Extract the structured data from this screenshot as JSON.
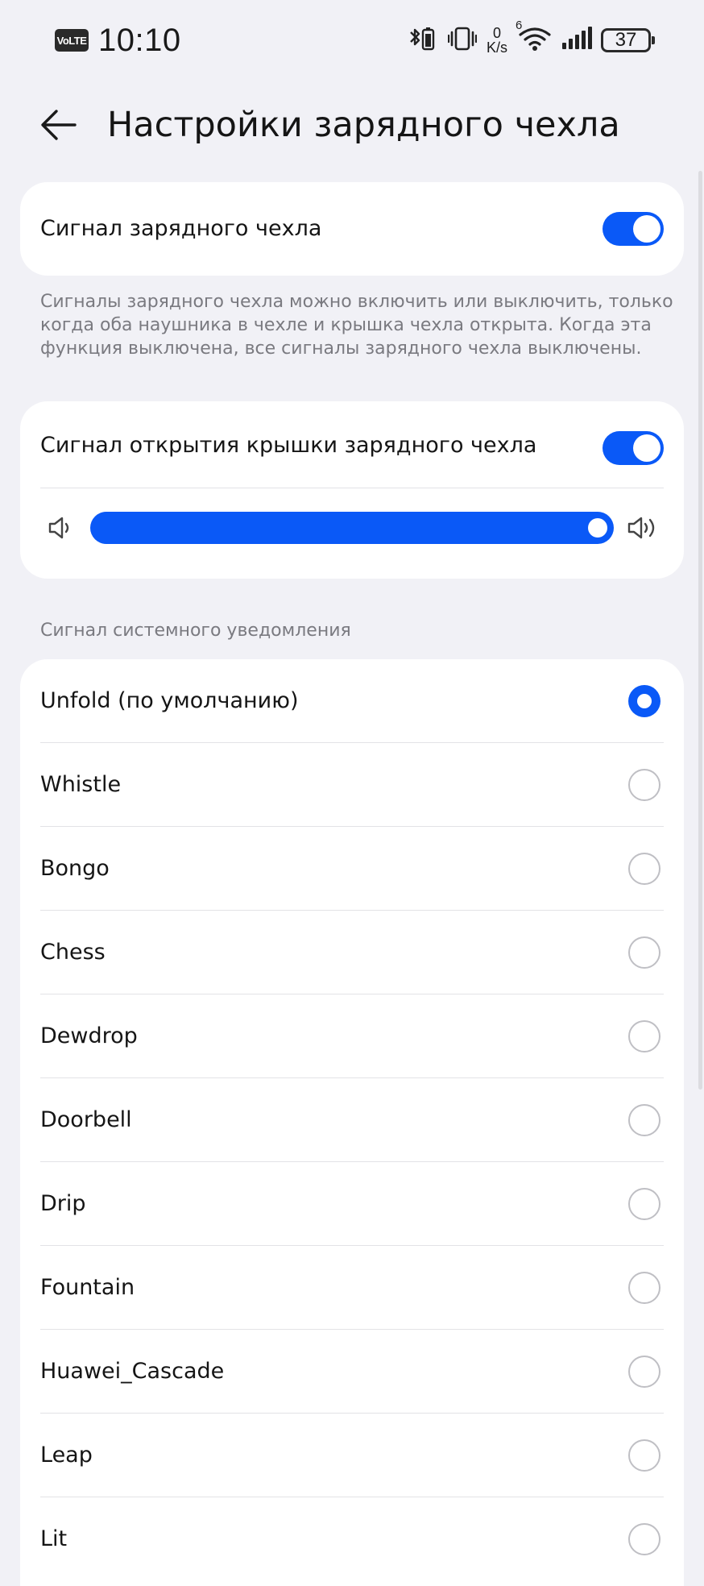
{
  "status_bar": {
    "volte": "VoLTE",
    "time": "10:10",
    "net_speed_value": "0",
    "net_speed_unit": "K/s",
    "wifi_gen": "6",
    "battery": "37"
  },
  "header": {
    "title": "Настройки зарядного чехла"
  },
  "case_signal": {
    "label": "Сигнал зарядного чехла",
    "enabled": true,
    "note": "Сигналы зарядного чехла можно включить или выключить, только когда оба наушника в чехле и крышка чехла открыта. Когда эта функция выключена, все сигналы зарядного чехла выключены."
  },
  "lid_signal": {
    "label": "Сигнал открытия крышки зарядного чехла",
    "enabled": true,
    "volume_fraction": 1.0
  },
  "system_sounds": {
    "title": "Сигнал системного уведомления",
    "selected_index": 0,
    "items": [
      {
        "label": "Unfold (по умолчанию)"
      },
      {
        "label": "Whistle"
      },
      {
        "label": "Bongo"
      },
      {
        "label": "Chess"
      },
      {
        "label": "Dewdrop"
      },
      {
        "label": "Doorbell"
      },
      {
        "label": "Drip"
      },
      {
        "label": "Fountain"
      },
      {
        "label": "Huawei_Cascade"
      },
      {
        "label": "Leap"
      },
      {
        "label": "Lit"
      }
    ]
  },
  "colors": {
    "accent": "#0a59f7",
    "background": "#f1f1f6",
    "card": "#ffffff",
    "secondary_text": "#7a7a80"
  }
}
